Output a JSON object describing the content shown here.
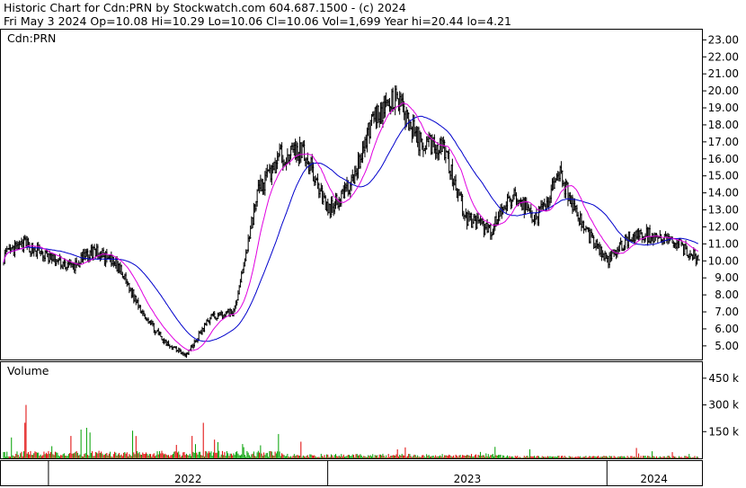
{
  "header": {
    "line1": "Historic Chart for Cdn:PRN by Stockwatch.com 604.687.1500 - (c) 2024",
    "line2": "Fri May  3 2024   Op=10.08  Hi=10.29  Lo=10.06  Cl=10.06  Vol=1,699  Year hi=20.44  lo=4.21"
  },
  "price_panel": {
    "symbol_label": "Cdn:PRN",
    "y_ticks": [
      "23.00",
      "22.00",
      "21.00",
      "20.00",
      "19.00",
      "18.00",
      "17.00",
      "16.00",
      "15.00",
      "14.00",
      "13.00",
      "12.00",
      "11.00",
      "10.00",
      "9.00",
      "8.00",
      "7.00",
      "6.00",
      "5.00"
    ]
  },
  "volume_panel": {
    "label": "Volume",
    "y_ticks": [
      "450 k",
      "300 k",
      "150 k"
    ]
  },
  "x_axis": {
    "years": [
      "2022",
      "2023",
      "2024"
    ]
  },
  "colors": {
    "up": "#00a000",
    "down": "#e00000",
    "ma_short": "#e000e0",
    "ma_long": "#0000cc",
    "price_bar": "#000000"
  },
  "chart_data": {
    "type": "line",
    "title": "Historic Chart for Cdn:PRN",
    "ylim": [
      4.2,
      23.6
    ],
    "volume_ylim": [
      0,
      540000
    ],
    "series": [
      {
        "name": "Cdn:PRN",
        "x": [
          "2021-11",
          "2021-12",
          "2022-01",
          "2022-02",
          "2022-03",
          "2022-04",
          "2022-05",
          "2022-06",
          "2022-07",
          "2022-08",
          "2022-09",
          "2022-10",
          "2022-11",
          "2022-12",
          "2023-01",
          "2023-02",
          "2023-03",
          "2023-04",
          "2023-05",
          "2023-06",
          "2023-07",
          "2023-08",
          "2023-09",
          "2023-10",
          "2023-11",
          "2023-12",
          "2024-01",
          "2024-02",
          "2024-03",
          "2024-04",
          "2024-05"
        ],
        "values": [
          10.2,
          11.0,
          10.2,
          9.6,
          10.6,
          9.7,
          7.2,
          5.2,
          4.5,
          6.7,
          7.0,
          14.0,
          16.2,
          16.5,
          13.0,
          14.5,
          18.5,
          19.5,
          17.0,
          16.8,
          12.5,
          11.8,
          13.8,
          12.5,
          15.0,
          12.0,
          10.0,
          11.5,
          11.5,
          11.0,
          10.06
        ]
      }
    ]
  }
}
